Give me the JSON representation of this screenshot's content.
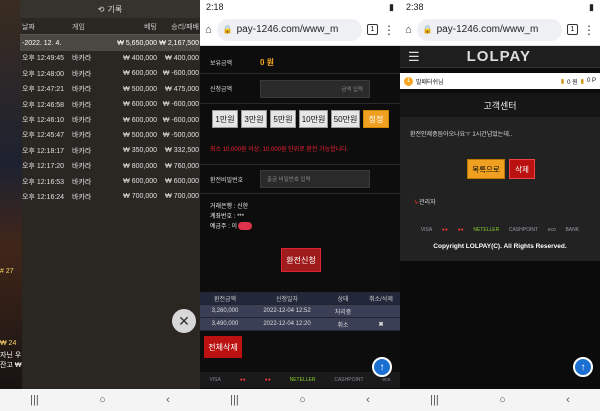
{
  "panel1": {
    "header_title": "기록",
    "columns": [
      "날짜",
      "게임",
      "베팅",
      "승리/패배"
    ],
    "date_band": {
      "date": "-2022. 12. 4.",
      "bet": "₩ 5,650,000",
      "result": "₩ 2,167,500"
    },
    "rows": [
      {
        "time": "오후 12:49:45",
        "game": "바카라",
        "bet": "₩ 400,000",
        "result": "₩ 400,000"
      },
      {
        "time": "오후 12:48:00",
        "game": "바카라",
        "bet": "₩ 600,000",
        "result": "₩ -600,000"
      },
      {
        "time": "오후 12:47:21",
        "game": "바카라",
        "bet": "₩ 500,000",
        "result": "₩ 475,000"
      },
      {
        "time": "오후 12:46:58",
        "game": "바카라",
        "bet": "₩ 600,000",
        "result": "₩ -600,000"
      },
      {
        "time": "오후 12:46:10",
        "game": "바카라",
        "bet": "₩ 600,000",
        "result": "₩ -600,000"
      },
      {
        "time": "오후 12:45:47",
        "game": "바카라",
        "bet": "₩ 500,000",
        "result": "₩ -500,000"
      },
      {
        "time": "오후 12:18:17",
        "game": "바카라",
        "bet": "₩ 350,000",
        "result": "₩ 332,500"
      },
      {
        "time": "오후 12:17:20",
        "game": "바카라",
        "bet": "₩ 800,000",
        "result": "₩ 760,000"
      },
      {
        "time": "오후 12:16:53",
        "game": "바카라",
        "bet": "₩ 600,000",
        "result": "₩ 600,000"
      },
      {
        "time": "오후 12:16:24",
        "game": "바카라",
        "bet": "₩ 700,000",
        "result": "₩ 700,000"
      }
    ],
    "side_frags": [
      "# 27",
      "₩ 24",
      "자닌 우",
      "잔고 ₩"
    ]
  },
  "panel2": {
    "status_time": "2:18",
    "url": "pay-1246.com/www_m",
    "tab_count": "1",
    "balance_label": "보유금액",
    "balance_value": "0 원",
    "apply_amount_label": "신청금액",
    "amount_placeholder": "금액 입력",
    "amount_buttons": [
      "1만원",
      "3만원",
      "5만원",
      "10만원",
      "50만원"
    ],
    "reset_label": "정정",
    "min_notice": "최소 10,000원 이상, 10,000원 단위로 환전 가능합니다.",
    "pw_label": "환전비밀번호",
    "pw_placeholder": "출금 비밀번호 입력",
    "bank_lines": [
      "거래은행 : 신한",
      "계좌번호 : ***",
      "예금주 : 이"
    ],
    "apply_button": "환전신청",
    "table_headers": [
      "환전금액",
      "신청일자",
      "상태",
      "취소/삭제"
    ],
    "table_rows": [
      {
        "amount": "3,260,000",
        "date": "2022-12-04 12:52",
        "status": "처리중",
        "action": ""
      },
      {
        "amount": "3,490,000",
        "date": "2022-12-04 12:20",
        "status": "취소",
        "action": "✖"
      }
    ],
    "delete_all": "전체삭제",
    "pay_logos": [
      "VISA",
      "●●",
      "●●",
      "NETELLER",
      "CASHPOINT",
      "eco"
    ]
  },
  "panel3": {
    "status_time": "2:38",
    "url": "pay-1246.com/www_m",
    "tab_count": "1",
    "logo": "LOLPAY",
    "user_name": "발패터쉬님",
    "user_level": "1",
    "money": "0 원",
    "points": "0 P",
    "cs_title": "고객센터",
    "cs_message": "환전안제중듬아오나요ㅜ 1시간넘었는데..",
    "btn_list": "목록으로",
    "btn_delete": "삭제",
    "admin_label": "관리자",
    "pay_logos": [
      "VISA",
      "●●",
      "●●",
      "NETELLER",
      "CASHPOINT",
      "eco",
      "BANK"
    ],
    "copyright": "Copyright LOLPAY(C). All Rights Reserved."
  },
  "nav": {
    "recent": "|||",
    "home": "○",
    "back": "‹"
  }
}
